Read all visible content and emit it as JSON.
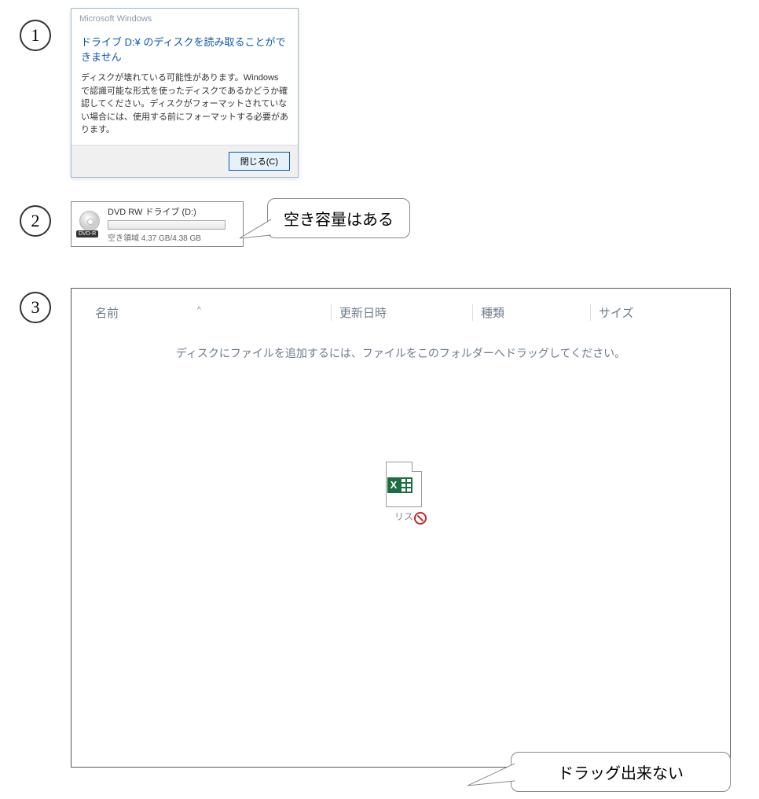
{
  "labels": {
    "num1": "1",
    "num2": "2",
    "num3": "3"
  },
  "dialog": {
    "window_title": "Microsoft Windows",
    "headline": "ドライブ D:¥ のディスクを読み取ることができません",
    "body": "ディスクが壊れている可能性があります。Windows で認識可能な形式を使ったディスクであるかどうか確認してください。ディスクがフォーマットされていない場合には、使用する前にフォーマットする必要があります。",
    "close_btn": "閉じる(C)"
  },
  "drive": {
    "name": "DVD RW ドライブ (D:)",
    "tag": "DVD-R",
    "free": "空き領域 4.37 GB/4.38 GB"
  },
  "callouts": {
    "c2": "空き容量はある",
    "c3": "ドラッグ出来ない"
  },
  "explorer": {
    "cols": {
      "name": "名前",
      "date": "更新日時",
      "type": "種類",
      "size": "サイズ"
    },
    "hint": "ディスクにファイルを追加するには、ファイルをこのフォルダーへドラッグしてください。",
    "drag_label": "リス"
  }
}
